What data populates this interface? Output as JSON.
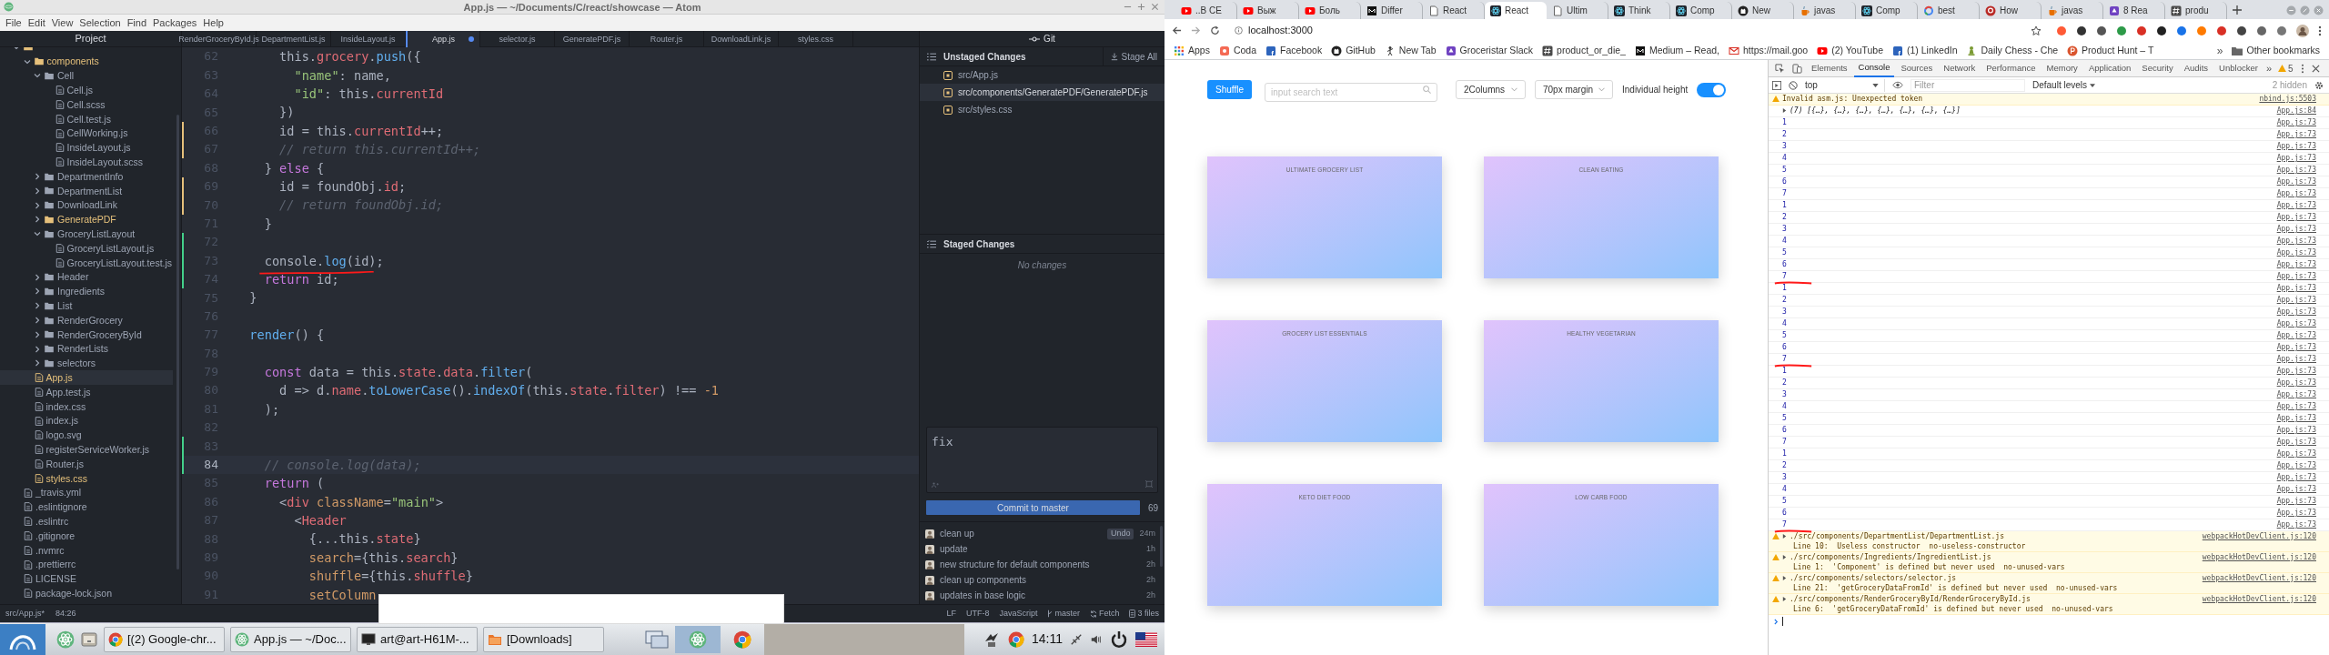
{
  "atom": {
    "title": "App.js — ~/Documents/C/react/showcase — Atom",
    "menu": [
      "File",
      "Edit",
      "View",
      "Selection",
      "Find",
      "Packages",
      "Help"
    ],
    "project": {
      "title": "Project",
      "tree": [
        {
          "kind": "folder",
          "expanded": true,
          "selected": false,
          "modified": true,
          "children": [
            {
              "name": "components",
              "kind": "folder",
              "expanded": true,
              "selected": false,
              "modified": true,
              "children": [
                {
                  "name": "Cell",
                  "kind": "folder",
                  "expanded": true,
                  "selected": false,
                  "modified": false,
                  "children": [
                    {
                      "name": "Cell.js",
                      "kind": "file",
                      "selected": false,
                      "modified": false
                    },
                    {
                      "name": "Cell.scss",
                      "kind": "file",
                      "selected": false,
                      "modified": false
                    },
                    {
                      "name": "Cell.test.js",
                      "kind": "file",
                      "selected": false,
                      "modified": false
                    },
                    {
                      "name": "CellWorking.js",
                      "kind": "file",
                      "selected": false,
                      "modified": false
                    },
                    {
                      "name": "InsideLayout.js",
                      "kind": "file",
                      "selected": false,
                      "modified": false
                    },
                    {
                      "name": "InsideLayout.scss",
                      "kind": "file",
                      "selected": false,
                      "modified": false
                    }
                  ]
                },
                {
                  "name": "DepartmentInfo",
                  "kind": "folder",
                  "expanded": false,
                  "selected": false,
                  "modified": false
                },
                {
                  "name": "DepartmentList",
                  "kind": "folder",
                  "expanded": false,
                  "selected": false,
                  "modified": false
                },
                {
                  "name": "DownloadLink",
                  "kind": "folder",
                  "expanded": false,
                  "selected": false,
                  "modified": false
                },
                {
                  "name": "GeneratePDF",
                  "kind": "folder",
                  "expanded": false,
                  "selected": false,
                  "modified": true
                },
                {
                  "name": "GroceryListLayout",
                  "kind": "folder",
                  "expanded": true,
                  "selected": false,
                  "modified": false,
                  "children": [
                    {
                      "name": "GroceryListLayout.js",
                      "kind": "file",
                      "selected": false,
                      "modified": false
                    },
                    {
                      "name": "GroceryListLayout.test.js",
                      "kind": "file",
                      "selected": false,
                      "modified": false
                    }
                  ]
                },
                {
                  "name": "Header",
                  "kind": "folder",
                  "expanded": false,
                  "selected": false,
                  "modified": false
                },
                {
                  "name": "Ingredients",
                  "kind": "folder",
                  "expanded": false,
                  "selected": false,
                  "modified": false
                },
                {
                  "name": "List",
                  "kind": "folder",
                  "expanded": false,
                  "selected": false,
                  "modified": false
                },
                {
                  "name": "RenderGrocery",
                  "kind": "folder",
                  "expanded": false,
                  "selected": false,
                  "modified": false
                },
                {
                  "name": "RenderGroceryById",
                  "kind": "folder",
                  "expanded": false,
                  "selected": false,
                  "modified": false
                },
                {
                  "name": "RenderLists",
                  "kind": "folder",
                  "expanded": false,
                  "selected": false,
                  "modified": false
                },
                {
                  "name": "selectors",
                  "kind": "folder",
                  "expanded": false,
                  "selected": false,
                  "modified": false
                }
              ]
            },
            {
              "name": "App.js",
              "kind": "file",
              "selected": true,
              "modified": true
            },
            {
              "name": "App.test.js",
              "kind": "file",
              "selected": false,
              "modified": false
            },
            {
              "name": "index.css",
              "kind": "file",
              "selected": false,
              "modified": false
            },
            {
              "name": "index.js",
              "kind": "file",
              "selected": false,
              "modified": false
            },
            {
              "name": "logo.svg",
              "kind": "file",
              "selected": false,
              "modified": false
            },
            {
              "name": "registerServiceWorker.js",
              "kind": "file",
              "selected": false,
              "modified": false
            },
            {
              "name": "Router.js",
              "kind": "file",
              "selected": false,
              "modified": false
            },
            {
              "name": "styles.css",
              "kind": "file",
              "selected": false,
              "modified": true
            }
          ]
        },
        {
          "name": "_travis.yml",
          "kind": "file",
          "selected": false,
          "modified": false
        },
        {
          "name": ".eslintignore",
          "kind": "file",
          "selected": false,
          "modified": false
        },
        {
          "name": ".eslintrc",
          "kind": "file",
          "selected": false,
          "modified": false
        },
        {
          "name": ".gitignore",
          "kind": "file",
          "selected": false,
          "modified": false
        },
        {
          "name": ".nvmrc",
          "kind": "file",
          "selected": false,
          "modified": false
        },
        {
          "name": ".prettierrc",
          "kind": "file",
          "selected": false,
          "modified": false
        },
        {
          "name": "LICENSE",
          "kind": "file",
          "selected": false,
          "modified": false
        },
        {
          "name": "package-lock.json",
          "kind": "file",
          "selected": false,
          "modified": false
        }
      ]
    },
    "tabs": [
      {
        "label": "RenderGroceryById.js",
        "selected": false,
        "modified": false
      },
      {
        "label": "DepartmentList.js",
        "selected": false,
        "modified": false
      },
      {
        "label": "InsideLayout.js",
        "selected": false,
        "modified": false
      },
      {
        "label": "App.js",
        "selected": true,
        "modified": true
      },
      {
        "label": "selector.js",
        "selected": false,
        "modified": false
      },
      {
        "label": "GeneratePDF.js",
        "selected": false,
        "modified": false
      },
      {
        "label": "Router.js",
        "selected": false,
        "modified": false
      },
      {
        "label": "DownloadLink.js",
        "selected": false,
        "modified": false
      },
      {
        "label": "styles.css",
        "selected": false,
        "modified": false
      }
    ],
    "code": [
      {
        "number": "62",
        "modified": false,
        "added": false,
        "current": false,
        "marked": false,
        "tokens": [
          {
            "text": "      this.",
            "kind": "plain"
          },
          {
            "text": "grocery",
            "kind": "prop"
          },
          {
            "text": ".",
            "kind": "plain"
          },
          {
            "text": "push",
            "kind": "fn"
          },
          {
            "text": "({",
            "kind": "plain"
          }
        ]
      },
      {
        "number": "63",
        "modified": false,
        "added": false,
        "current": false,
        "marked": false,
        "tokens": [
          {
            "text": "        \"name\"",
            "kind": "str"
          },
          {
            "text": ": name,",
            "kind": "plain"
          }
        ]
      },
      {
        "number": "64",
        "modified": false,
        "added": false,
        "current": false,
        "marked": false,
        "tokens": [
          {
            "text": "        \"id\"",
            "kind": "str"
          },
          {
            "text": ": this.",
            "kind": "plain"
          },
          {
            "text": "currentId",
            "kind": "prop"
          }
        ]
      },
      {
        "number": "65",
        "modified": false,
        "added": false,
        "current": false,
        "marked": false,
        "tokens": [
          {
            "text": "      })",
            "kind": "plain"
          }
        ]
      },
      {
        "number": "66",
        "modified": true,
        "added": false,
        "current": false,
        "marked": false,
        "tokens": [
          {
            "text": "      id = this.",
            "kind": "plain"
          },
          {
            "text": "currentId",
            "kind": "prop"
          },
          {
            "text": "++;",
            "kind": "plain"
          }
        ]
      },
      {
        "number": "67",
        "modified": true,
        "added": false,
        "current": false,
        "marked": false,
        "tokens": [
          {
            "text": "      // return this.currentId++;",
            "kind": "com"
          }
        ]
      },
      {
        "number": "68",
        "modified": false,
        "added": false,
        "current": false,
        "marked": false,
        "tokens": [
          {
            "text": "    } ",
            "kind": "plain"
          },
          {
            "text": "else",
            "kind": "kw"
          },
          {
            "text": " {",
            "kind": "plain"
          }
        ]
      },
      {
        "number": "69",
        "modified": true,
        "added": false,
        "current": false,
        "marked": false,
        "tokens": [
          {
            "text": "      id = foundObj.",
            "kind": "plain"
          },
          {
            "text": "id",
            "kind": "prop"
          },
          {
            "text": ";",
            "kind": "plain"
          }
        ]
      },
      {
        "number": "70",
        "modified": true,
        "added": false,
        "current": false,
        "marked": false,
        "tokens": [
          {
            "text": "      // return foundObj.id;",
            "kind": "com"
          }
        ]
      },
      {
        "number": "71",
        "modified": false,
        "added": false,
        "current": false,
        "marked": false,
        "tokens": [
          {
            "text": "    }",
            "kind": "plain"
          }
        ]
      },
      {
        "number": "72",
        "modified": false,
        "added": true,
        "current": false,
        "marked": false
      },
      {
        "number": "73",
        "modified": false,
        "added": true,
        "current": false,
        "marked": true,
        "tokens": [
          {
            "text": "    console.",
            "kind": "plain"
          },
          {
            "text": "log",
            "kind": "fn"
          },
          {
            "text": "(id);",
            "kind": "plain"
          }
        ]
      },
      {
        "number": "74",
        "modified": false,
        "added": true,
        "current": false,
        "marked": false,
        "tokens": [
          {
            "text": "    return",
            "kind": "kw"
          },
          {
            "text": " id;",
            "kind": "plain"
          }
        ]
      },
      {
        "number": "75",
        "modified": false,
        "added": false,
        "current": false,
        "marked": false,
        "tokens": [
          {
            "text": "  }",
            "kind": "plain"
          }
        ]
      },
      {
        "number": "76",
        "modified": false,
        "added": false,
        "current": false,
        "marked": false
      },
      {
        "number": "77",
        "modified": false,
        "added": false,
        "current": false,
        "marked": false,
        "tokens": [
          {
            "text": "  render",
            "kind": "fn"
          },
          {
            "text": "() {",
            "kind": "plain"
          }
        ]
      },
      {
        "number": "78",
        "modified": false,
        "added": false,
        "current": false,
        "marked": false
      },
      {
        "number": "79",
        "modified": false,
        "added": false,
        "current": false,
        "marked": false,
        "tokens": [
          {
            "text": "    const",
            "kind": "kw"
          },
          {
            "text": " data = this.",
            "kind": "plain"
          },
          {
            "text": "state",
            "kind": "prop"
          },
          {
            "text": ".",
            "kind": "plain"
          },
          {
            "text": "data",
            "kind": "prop"
          },
          {
            "text": ".",
            "kind": "plain"
          },
          {
            "text": "filter",
            "kind": "fn"
          },
          {
            "text": "(",
            "kind": "plain"
          }
        ]
      },
      {
        "number": "80",
        "modified": false,
        "added": false,
        "current": false,
        "marked": false,
        "tokens": [
          {
            "text": "      d => d.",
            "kind": "plain"
          },
          {
            "text": "name",
            "kind": "prop"
          },
          {
            "text": ".",
            "kind": "plain"
          },
          {
            "text": "toLowerCase",
            "kind": "fn"
          },
          {
            "text": "().",
            "kind": "plain"
          },
          {
            "text": "indexOf",
            "kind": "fn"
          },
          {
            "text": "(this.",
            "kind": "plain"
          },
          {
            "text": "state",
            "kind": "prop"
          },
          {
            "text": ".",
            "kind": "plain"
          },
          {
            "text": "filter",
            "kind": "prop"
          },
          {
            "text": ") !== ",
            "kind": "plain"
          },
          {
            "text": "-1",
            "kind": "num"
          }
        ]
      },
      {
        "number": "81",
        "modified": false,
        "added": false,
        "current": false,
        "marked": false,
        "tokens": [
          {
            "text": "    );",
            "kind": "plain"
          }
        ]
      },
      {
        "number": "82",
        "modified": false,
        "added": false,
        "current": false,
        "marked": false
      },
      {
        "number": "83",
        "modified": false,
        "added": true,
        "current": false,
        "marked": false
      },
      {
        "number": "84",
        "modified": false,
        "added": true,
        "current": true,
        "marked": false,
        "tokens": [
          {
            "text": "    // console.log(data);",
            "kind": "com"
          }
        ]
      },
      {
        "number": "85",
        "modified": false,
        "added": false,
        "current": false,
        "marked": false,
        "tokens": [
          {
            "text": "    return",
            "kind": "kw"
          },
          {
            "text": " (",
            "kind": "plain"
          }
        ]
      },
      {
        "number": "86",
        "modified": false,
        "added": false,
        "current": false,
        "marked": false,
        "tokens": [
          {
            "text": "      <",
            "kind": "plain"
          },
          {
            "text": "div",
            "kind": "tag"
          },
          {
            "text": " className",
            "kind": "attr"
          },
          {
            "text": "=",
            "kind": "plain"
          },
          {
            "text": "\"main\"",
            "kind": "str"
          },
          {
            "text": ">",
            "kind": "plain"
          }
        ]
      },
      {
        "number": "87",
        "modified": false,
        "added": false,
        "current": false,
        "marked": false,
        "tokens": [
          {
            "text": "        <",
            "kind": "plain"
          },
          {
            "text": "Header",
            "kind": "tag"
          }
        ]
      },
      {
        "number": "88",
        "modified": false,
        "added": false,
        "current": false,
        "marked": false,
        "tokens": [
          {
            "text": "          {...this.",
            "kind": "plain"
          },
          {
            "text": "state",
            "kind": "prop"
          },
          {
            "text": "}",
            "kind": "plain"
          }
        ]
      },
      {
        "number": "89",
        "modified": false,
        "added": false,
        "current": false,
        "marked": false,
        "tokens": [
          {
            "text": "          search",
            "kind": "attr"
          },
          {
            "text": "={this.",
            "kind": "plain"
          },
          {
            "text": "search",
            "kind": "prop"
          },
          {
            "text": "}",
            "kind": "plain"
          }
        ]
      },
      {
        "number": "90",
        "modified": false,
        "added": false,
        "current": false,
        "marked": false,
        "tokens": [
          {
            "text": "          shuffle",
            "kind": "attr"
          },
          {
            "text": "={this.",
            "kind": "plain"
          },
          {
            "text": "shuffle",
            "kind": "prop"
          },
          {
            "text": "}",
            "kind": "plain"
          }
        ]
      },
      {
        "number": "91",
        "modified": false,
        "added": false,
        "current": false,
        "marked": false,
        "tokens": [
          {
            "text": "          setColumn",
            "kind": "attr"
          }
        ]
      }
    ],
    "git": {
      "title": "Git",
      "unstaged": {
        "title": "Unstaged Changes",
        "action": "Stage All",
        "files": [
          {
            "path": "src/App.js",
            "selected": false
          },
          {
            "path": "src/components/GeneratePDF/GeneratePDF.js",
            "selected": true
          },
          {
            "path": "src/styles.css",
            "selected": false
          }
        ]
      },
      "staged": {
        "title": "Staged Changes",
        "empty": "No changes"
      },
      "commit_message": "fix",
      "remaining": "69",
      "commit_button": "Commit to master",
      "commits": [
        {
          "message": "clean up",
          "time": "24m",
          "undo": "Undo"
        },
        {
          "message": "update",
          "time": "1h"
        },
        {
          "message": "new structure for default components",
          "time": "2h"
        },
        {
          "message": "clean up components",
          "time": "2h"
        },
        {
          "message": "updates in base logic",
          "time": "2h"
        }
      ]
    },
    "status_bar": {
      "path": "src/App.js*",
      "cursor": "84:26",
      "line_ending": "LF",
      "encoding": "UTF-8",
      "grammar": "JavaScript",
      "branch": "master",
      "fetch": "Fetch",
      "changes": "3 files"
    }
  },
  "taskbar": {
    "tasks": [
      {
        "label": "[(2) Google-chr...",
        "kind": "chrome"
      },
      {
        "label": "App.js — ~/Doc...",
        "kind": "atom"
      },
      {
        "label": "art@art-H61M-...",
        "kind": "monitor"
      },
      {
        "label": "[Downloads]",
        "kind": "folder"
      }
    ],
    "clock": "14:11"
  },
  "browser": {
    "tabs": [
      {
        "label": "..B CE",
        "kind": "play",
        "selected": false
      },
      {
        "label": "Выж",
        "kind": "play",
        "selected": false
      },
      {
        "label": "Боль",
        "kind": "play",
        "selected": false
      },
      {
        "label": "Differ",
        "kind": "black",
        "selected": false
      },
      {
        "label": "React",
        "kind": "page",
        "selected": false
      },
      {
        "label": "React",
        "kind": "atom",
        "selected": true
      },
      {
        "label": "Ultim",
        "kind": "page",
        "selected": false
      },
      {
        "label": "Think",
        "kind": "atom",
        "selected": false
      },
      {
        "label": "Comp",
        "kind": "atom",
        "selected": false
      },
      {
        "label": "New",
        "kind": "github",
        "selected": false
      },
      {
        "label": "javas",
        "kind": "cup",
        "selected": false
      },
      {
        "label": "Comp",
        "kind": "atom",
        "selected": false
      },
      {
        "label": "best",
        "kind": "google",
        "selected": false
      },
      {
        "label": "How",
        "kind": "red",
        "selected": false
      },
      {
        "label": "javas",
        "kind": "cup",
        "selected": false
      },
      {
        "label": "8 Rea",
        "kind": "purple",
        "selected": false
      },
      {
        "label": "produ",
        "kind": "hash",
        "selected": false
      }
    ],
    "address": "localhost:3000",
    "bookmarks": [
      {
        "label": "Apps",
        "kind": "grid"
      },
      {
        "label": "Coda",
        "kind": "orange"
      },
      {
        "label": "Facebook",
        "kind": "blue"
      },
      {
        "label": "GitHub",
        "kind": "github"
      },
      {
        "label": "New Tab",
        "kind": "figure"
      },
      {
        "label": "Groceristar Slack",
        "kind": "purple"
      },
      {
        "label": "product_or_die_",
        "kind": "hash"
      },
      {
        "label": "Medium – Read,",
        "kind": "black"
      },
      {
        "label": "https://mail.goo",
        "kind": "mail"
      },
      {
        "label": "(2) YouTube",
        "kind": "play"
      },
      {
        "label": "(1) LinkedIn",
        "kind": "blue"
      },
      {
        "label": "Daily Chess - Che",
        "kind": "pawn"
      },
      {
        "label": "Product Hunt – T",
        "kind": "orangecircle"
      }
    ],
    "more_bookmarks": "»",
    "other_bookmarks": "Other bookmarks",
    "page": {
      "shuffle": "Shuffle",
      "search_placeholder": "input search text",
      "columns": "2Columns",
      "margin": "70px margin",
      "height_label": "Individual height",
      "individual_height": true,
      "cards": [
        {
          "title": "ULTIMATE GROCERY LIST"
        },
        {
          "title": "CLEAN EATING"
        },
        {
          "title": "GROCERY LIST ESSENTIALS"
        },
        {
          "title": "HEALTHY VEGETARIAN"
        },
        {
          "title": "KETO DIET FOOD"
        },
        {
          "title": "LOW CARB FOOD"
        }
      ]
    },
    "devtools": {
      "tabs": [
        {
          "label": "Elements",
          "selected": false
        },
        {
          "label": "Console",
          "selected": true
        },
        {
          "label": "Sources",
          "selected": false
        },
        {
          "label": "Network",
          "selected": false
        },
        {
          "label": "Performance",
          "selected": false
        },
        {
          "label": "Memory",
          "selected": false
        },
        {
          "label": "Application",
          "selected": false
        },
        {
          "label": "Security",
          "selected": false
        },
        {
          "label": "Audits",
          "selected": false
        },
        {
          "label": "Unblocker",
          "selected": false
        }
      ],
      "more": "»",
      "warning_count": "5",
      "context": "top",
      "filter_placeholder": "Filter",
      "levels": "Default levels",
      "hidden": "2 hidden",
      "messages": [
        {
          "kind": "warning",
          "text": "Invalid asm.js: Unexpected token",
          "source": "nbind.js:5503"
        },
        {
          "kind": "object",
          "text": "(7) [{…}, {…}, {…}, {…}, {…}, {…}, {…}]",
          "source": "App.js:84"
        },
        {
          "kind": "log",
          "text": "1",
          "source": "App.js:73",
          "marked": false
        },
        {
          "kind": "log",
          "text": "2",
          "source": "App.js:73",
          "marked": false
        },
        {
          "kind": "log",
          "text": "3",
          "source": "App.js:73",
          "marked": false
        },
        {
          "kind": "log",
          "text": "4",
          "source": "App.js:73",
          "marked": false
        },
        {
          "kind": "log",
          "text": "5",
          "source": "App.js:73",
          "marked": false
        },
        {
          "kind": "log",
          "text": "6",
          "source": "App.js:73",
          "marked": false
        },
        {
          "kind": "log",
          "text": "7",
          "source": "App.js:73",
          "marked": false
        },
        {
          "kind": "log",
          "text": "1",
          "source": "App.js:73",
          "marked": false
        },
        {
          "kind": "log",
          "text": "2",
          "source": "App.js:73",
          "marked": false
        },
        {
          "kind": "log",
          "text": "3",
          "source": "App.js:73",
          "marked": false
        },
        {
          "kind": "log",
          "text": "4",
          "source": "App.js:73",
          "marked": false
        },
        {
          "kind": "log",
          "text": "5",
          "source": "App.js:73",
          "marked": false
        },
        {
          "kind": "log",
          "text": "6",
          "source": "App.js:73",
          "marked": false
        },
        {
          "kind": "log",
          "text": "7",
          "source": "App.js:73",
          "marked": true
        },
        {
          "kind": "log",
          "text": "1",
          "source": "App.js:73",
          "marked": false
        },
        {
          "kind": "log",
          "text": "2",
          "source": "App.js:73",
          "marked": false
        },
        {
          "kind": "log",
          "text": "3",
          "source": "App.js:73",
          "marked": false
        },
        {
          "kind": "log",
          "text": "4",
          "source": "App.js:73",
          "marked": false
        },
        {
          "kind": "log",
          "text": "5",
          "source": "App.js:73",
          "marked": false
        },
        {
          "kind": "log",
          "text": "6",
          "source": "App.js:73",
          "marked": false
        },
        {
          "kind": "log",
          "text": "7",
          "source": "App.js:73",
          "marked": true
        },
        {
          "kind": "log",
          "text": "1",
          "source": "App.js:73",
          "marked": false
        },
        {
          "kind": "log",
          "text": "2",
          "source": "App.js:73",
          "marked": false
        },
        {
          "kind": "log",
          "text": "3",
          "source": "App.js:73",
          "marked": false
        },
        {
          "kind": "log",
          "text": "4",
          "source": "App.js:73",
          "marked": false
        },
        {
          "kind": "log",
          "text": "5",
          "source": "App.js:73",
          "marked": false
        },
        {
          "kind": "log",
          "text": "6",
          "source": "App.js:73",
          "marked": false
        },
        {
          "kind": "log",
          "text": "7",
          "source": "App.js:73",
          "marked": false
        },
        {
          "kind": "log",
          "text": "1",
          "source": "App.js:73",
          "marked": false
        },
        {
          "kind": "log",
          "text": "2",
          "source": "App.js:73",
          "marked": false
        },
        {
          "kind": "log",
          "text": "3",
          "source": "App.js:73",
          "marked": false
        },
        {
          "kind": "log",
          "text": "4",
          "source": "App.js:73",
          "marked": false
        },
        {
          "kind": "log",
          "text": "5",
          "source": "App.js:73",
          "marked": false
        },
        {
          "kind": "log",
          "text": "6",
          "source": "App.js:73",
          "marked": false
        },
        {
          "kind": "log",
          "text": "7",
          "source": "App.js:73",
          "marked": true
        },
        {
          "kind": "warning",
          "text": "./src/components/DepartmentList/DepartmentList.js",
          "detail": "Line 10:  Useless constructor  no-useless-constructor",
          "source": "webpackHotDevClient.js:120"
        },
        {
          "kind": "warning",
          "text": "./src/components/Ingredients/IngredientList.js",
          "detail": "Line 1:  'Component' is defined but never used  no-unused-vars",
          "source": "webpackHotDevClient.js:120"
        },
        {
          "kind": "warning",
          "text": "./src/components/selectors/selector.js",
          "detail": "Line 21:  'getGroceryDataFromId' is defined but never used  no-unused-vars",
          "source": "webpackHotDevClient.js:120"
        },
        {
          "kind": "warning",
          "text": "./src/components/RenderGroceryById/RenderGroceryById.js",
          "detail": "Line 6:  'getGroceryDataFromId' is defined but never used  no-unused-vars",
          "source": "webpackHotDevClient.js:120"
        }
      ]
    }
  }
}
